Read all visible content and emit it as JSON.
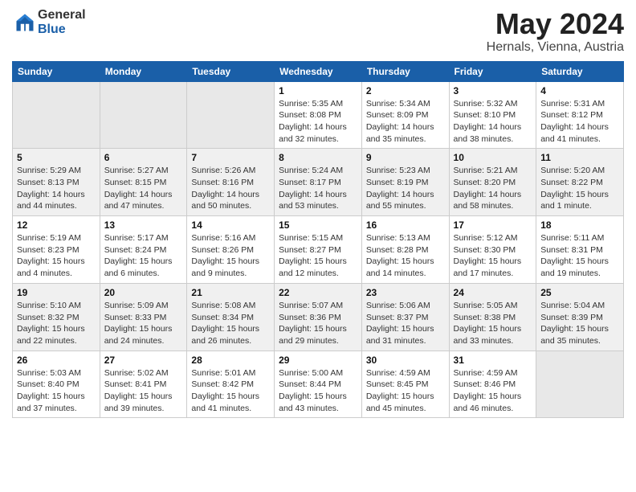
{
  "logo": {
    "general": "General",
    "blue": "Blue"
  },
  "title": {
    "month": "May 2024",
    "location": "Hernals, Vienna, Austria"
  },
  "weekdays": [
    "Sunday",
    "Monday",
    "Tuesday",
    "Wednesday",
    "Thursday",
    "Friday",
    "Saturday"
  ],
  "rows": [
    [
      {
        "day": "",
        "sunrise": "",
        "sunset": "",
        "daylight": ""
      },
      {
        "day": "",
        "sunrise": "",
        "sunset": "",
        "daylight": ""
      },
      {
        "day": "",
        "sunrise": "",
        "sunset": "",
        "daylight": ""
      },
      {
        "day": "1",
        "sunrise": "Sunrise: 5:35 AM",
        "sunset": "Sunset: 8:08 PM",
        "daylight": "Daylight: 14 hours and 32 minutes."
      },
      {
        "day": "2",
        "sunrise": "Sunrise: 5:34 AM",
        "sunset": "Sunset: 8:09 PM",
        "daylight": "Daylight: 14 hours and 35 minutes."
      },
      {
        "day": "3",
        "sunrise": "Sunrise: 5:32 AM",
        "sunset": "Sunset: 8:10 PM",
        "daylight": "Daylight: 14 hours and 38 minutes."
      },
      {
        "day": "4",
        "sunrise": "Sunrise: 5:31 AM",
        "sunset": "Sunset: 8:12 PM",
        "daylight": "Daylight: 14 hours and 41 minutes."
      }
    ],
    [
      {
        "day": "5",
        "sunrise": "Sunrise: 5:29 AM",
        "sunset": "Sunset: 8:13 PM",
        "daylight": "Daylight: 14 hours and 44 minutes."
      },
      {
        "day": "6",
        "sunrise": "Sunrise: 5:27 AM",
        "sunset": "Sunset: 8:15 PM",
        "daylight": "Daylight: 14 hours and 47 minutes."
      },
      {
        "day": "7",
        "sunrise": "Sunrise: 5:26 AM",
        "sunset": "Sunset: 8:16 PM",
        "daylight": "Daylight: 14 hours and 50 minutes."
      },
      {
        "day": "8",
        "sunrise": "Sunrise: 5:24 AM",
        "sunset": "Sunset: 8:17 PM",
        "daylight": "Daylight: 14 hours and 53 minutes."
      },
      {
        "day": "9",
        "sunrise": "Sunrise: 5:23 AM",
        "sunset": "Sunset: 8:19 PM",
        "daylight": "Daylight: 14 hours and 55 minutes."
      },
      {
        "day": "10",
        "sunrise": "Sunrise: 5:21 AM",
        "sunset": "Sunset: 8:20 PM",
        "daylight": "Daylight: 14 hours and 58 minutes."
      },
      {
        "day": "11",
        "sunrise": "Sunrise: 5:20 AM",
        "sunset": "Sunset: 8:22 PM",
        "daylight": "Daylight: 15 hours and 1 minute."
      }
    ],
    [
      {
        "day": "12",
        "sunrise": "Sunrise: 5:19 AM",
        "sunset": "Sunset: 8:23 PM",
        "daylight": "Daylight: 15 hours and 4 minutes."
      },
      {
        "day": "13",
        "sunrise": "Sunrise: 5:17 AM",
        "sunset": "Sunset: 8:24 PM",
        "daylight": "Daylight: 15 hours and 6 minutes."
      },
      {
        "day": "14",
        "sunrise": "Sunrise: 5:16 AM",
        "sunset": "Sunset: 8:26 PM",
        "daylight": "Daylight: 15 hours and 9 minutes."
      },
      {
        "day": "15",
        "sunrise": "Sunrise: 5:15 AM",
        "sunset": "Sunset: 8:27 PM",
        "daylight": "Daylight: 15 hours and 12 minutes."
      },
      {
        "day": "16",
        "sunrise": "Sunrise: 5:13 AM",
        "sunset": "Sunset: 8:28 PM",
        "daylight": "Daylight: 15 hours and 14 minutes."
      },
      {
        "day": "17",
        "sunrise": "Sunrise: 5:12 AM",
        "sunset": "Sunset: 8:30 PM",
        "daylight": "Daylight: 15 hours and 17 minutes."
      },
      {
        "day": "18",
        "sunrise": "Sunrise: 5:11 AM",
        "sunset": "Sunset: 8:31 PM",
        "daylight": "Daylight: 15 hours and 19 minutes."
      }
    ],
    [
      {
        "day": "19",
        "sunrise": "Sunrise: 5:10 AM",
        "sunset": "Sunset: 8:32 PM",
        "daylight": "Daylight: 15 hours and 22 minutes."
      },
      {
        "day": "20",
        "sunrise": "Sunrise: 5:09 AM",
        "sunset": "Sunset: 8:33 PM",
        "daylight": "Daylight: 15 hours and 24 minutes."
      },
      {
        "day": "21",
        "sunrise": "Sunrise: 5:08 AM",
        "sunset": "Sunset: 8:34 PM",
        "daylight": "Daylight: 15 hours and 26 minutes."
      },
      {
        "day": "22",
        "sunrise": "Sunrise: 5:07 AM",
        "sunset": "Sunset: 8:36 PM",
        "daylight": "Daylight: 15 hours and 29 minutes."
      },
      {
        "day": "23",
        "sunrise": "Sunrise: 5:06 AM",
        "sunset": "Sunset: 8:37 PM",
        "daylight": "Daylight: 15 hours and 31 minutes."
      },
      {
        "day": "24",
        "sunrise": "Sunrise: 5:05 AM",
        "sunset": "Sunset: 8:38 PM",
        "daylight": "Daylight: 15 hours and 33 minutes."
      },
      {
        "day": "25",
        "sunrise": "Sunrise: 5:04 AM",
        "sunset": "Sunset: 8:39 PM",
        "daylight": "Daylight: 15 hours and 35 minutes."
      }
    ],
    [
      {
        "day": "26",
        "sunrise": "Sunrise: 5:03 AM",
        "sunset": "Sunset: 8:40 PM",
        "daylight": "Daylight: 15 hours and 37 minutes."
      },
      {
        "day": "27",
        "sunrise": "Sunrise: 5:02 AM",
        "sunset": "Sunset: 8:41 PM",
        "daylight": "Daylight: 15 hours and 39 minutes."
      },
      {
        "day": "28",
        "sunrise": "Sunrise: 5:01 AM",
        "sunset": "Sunset: 8:42 PM",
        "daylight": "Daylight: 15 hours and 41 minutes."
      },
      {
        "day": "29",
        "sunrise": "Sunrise: 5:00 AM",
        "sunset": "Sunset: 8:44 PM",
        "daylight": "Daylight: 15 hours and 43 minutes."
      },
      {
        "day": "30",
        "sunrise": "Sunrise: 4:59 AM",
        "sunset": "Sunset: 8:45 PM",
        "daylight": "Daylight: 15 hours and 45 minutes."
      },
      {
        "day": "31",
        "sunrise": "Sunrise: 4:59 AM",
        "sunset": "Sunset: 8:46 PM",
        "daylight": "Daylight: 15 hours and 46 minutes."
      },
      {
        "day": "",
        "sunrise": "",
        "sunset": "",
        "daylight": ""
      }
    ]
  ]
}
